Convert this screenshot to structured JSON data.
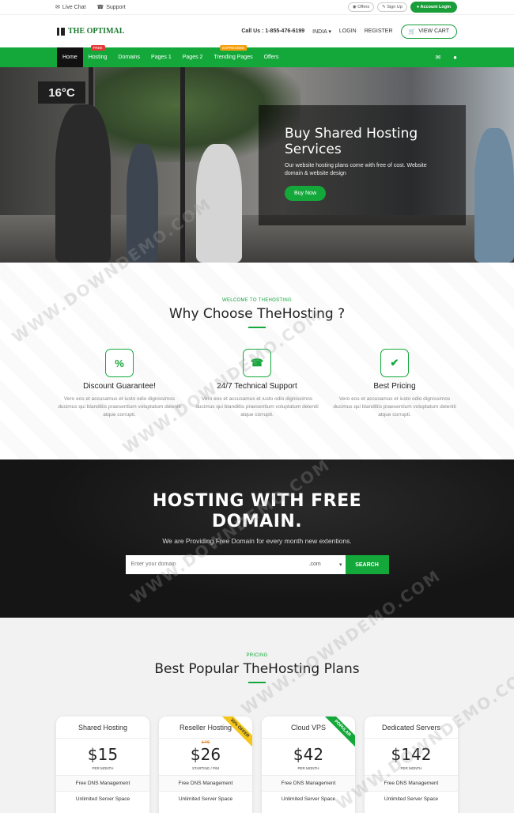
{
  "topbar": {
    "live_chat": "Live Chat",
    "support": "Support",
    "offers": "Offers",
    "sign_up": "Sign Up",
    "account_login": "Account Login"
  },
  "header": {
    "logo": "THE OPTIMAL",
    "call": "Call Us : 1-855-476-6199",
    "country": "INDIA",
    "login": "LOGIN",
    "register": "REGISTER",
    "cart": "VIEW CART"
  },
  "nav": {
    "items": [
      {
        "label": "Home"
      },
      {
        "label": "Hosting",
        "badge": "FREE"
      },
      {
        "label": "Domains"
      },
      {
        "label": "Pages 1"
      },
      {
        "label": "Pages 2"
      },
      {
        "label": "Trending Pages",
        "badge": "EXPRESSED"
      },
      {
        "label": "Offers"
      }
    ]
  },
  "hero": {
    "sign_text": "16°C",
    "title": "Buy Shared Hosting Services",
    "text": "Our website hosting plans come with free of cost. Website domain & website design",
    "button": "Buy Now"
  },
  "why": {
    "eyebrow": "WELCOME TO THEHOSTING",
    "title": "Why Choose TheHosting ?",
    "features": [
      {
        "icon": "%",
        "title": "Discount Guarantee!",
        "text": "Vero eos et accusamus et iusto odio dignissimos ducimus qui blanditiis praesentium voluptatum deleniti atque corrupti."
      },
      {
        "icon": "☎",
        "title": "24/7 Technical Support",
        "text": "Vero eos et accusamus et iusto odio dignissimos ducimus qui blanditiis praesentium voluptatum deleniti atque corrupti."
      },
      {
        "icon": "✔",
        "title": "Best Pricing",
        "text": "Vero eos et accusamus et iusto odio dignissimos ducimus qui blanditiis praesentium voluptatum deleniti atque corrupti."
      }
    ]
  },
  "domain": {
    "title_line1": "HOSTING WITH FREE",
    "title_line2": "DOMAIN.",
    "subtitle": "We are Providing Free Domain for every month new extentions.",
    "placeholder": "Enter your domain",
    "tld": ".com",
    "button": "SEARCH"
  },
  "pricing": {
    "eyebrow": "PRICING",
    "title": "Best Popular TheHosting Plans",
    "plans": [
      {
        "name": "Shared Hosting",
        "price": "$15",
        "per": "PER MONTH",
        "features": [
          "Free DNS Management",
          "Unlimited Server Space"
        ]
      },
      {
        "name": "Reseller Hosting",
        "price": "$26",
        "old_price": "$46",
        "per": "STARTING / P/M",
        "ribbon": "30% OFFER",
        "features": [
          "Free DNS Management",
          "Unlimited Server Space"
        ]
      },
      {
        "name": "Cloud VPS",
        "price": "$42",
        "per": "PER MONTH",
        "ribbon": "POPULAR",
        "features": [
          "Free DNS Management",
          "Unlimited Server Space"
        ]
      },
      {
        "name": "Dedicated Servers",
        "price": "$142",
        "per": "PER MONTH",
        "features": [
          "Free DNS Management",
          "Unlimited Server Space"
        ]
      }
    ]
  },
  "watermark": "WWW.DOWNDEMO.COM",
  "colors": {
    "accent": "#14a83b",
    "dark": "#151515",
    "ribbon_yellow": "#f5c518"
  }
}
